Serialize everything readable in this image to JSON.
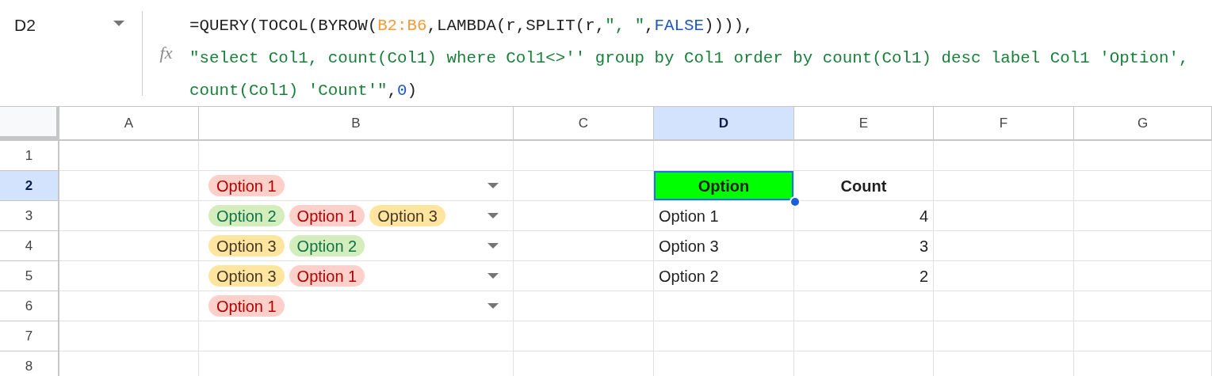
{
  "name_box": {
    "text": "D2"
  },
  "formula": {
    "icon_text": "fx",
    "lines": [
      [
        {
          "kind": "plain",
          "text": "=QUERY(TOCOL(BYROW("
        },
        {
          "kind": "range",
          "text": "B2:B6"
        },
        {
          "kind": "plain",
          "text": ",LAMBDA(r,SPLIT(r,"
        },
        {
          "kind": "string",
          "text": "\", \""
        },
        {
          "kind": "plain",
          "text": ","
        },
        {
          "kind": "bool",
          "text": "FALSE"
        },
        {
          "kind": "plain",
          "text": ")))),"
        }
      ],
      [
        {
          "kind": "string",
          "text": "\"select Col1, count(Col1) where Col1<>'' group by Col1 order by count(Col1) desc label Col1 'Option',"
        }
      ],
      [
        {
          "kind": "string",
          "text": "count(Col1) 'Count'\""
        },
        {
          "kind": "plain",
          "text": ","
        },
        {
          "kind": "number",
          "text": "0"
        },
        {
          "kind": "plain",
          "text": ")"
        }
      ]
    ]
  },
  "columns": [
    {
      "label": "A",
      "selected": false
    },
    {
      "label": "B",
      "selected": false
    },
    {
      "label": "C",
      "selected": false
    },
    {
      "label": "D",
      "selected": true
    },
    {
      "label": "E",
      "selected": false
    },
    {
      "label": "F",
      "selected": false
    },
    {
      "label": "G",
      "selected": false
    }
  ],
  "rows": [
    {
      "label": "1",
      "selected": false,
      "cells": [
        {
          "kind": "empty"
        },
        {
          "kind": "empty"
        },
        {
          "kind": "empty"
        },
        {
          "kind": "empty"
        },
        {
          "kind": "empty"
        },
        {
          "kind": "empty"
        },
        {
          "kind": "empty"
        }
      ]
    },
    {
      "label": "2",
      "selected": true,
      "cells": [
        {
          "kind": "empty"
        },
        {
          "kind": "chips",
          "chips": [
            {
              "label": "Option 1",
              "color": "#ffcfc9"
            }
          ]
        },
        {
          "kind": "empty"
        },
        {
          "kind": "header",
          "text": "Option",
          "color": "#00ff00"
        },
        {
          "kind": "header",
          "text": "Count"
        },
        {
          "kind": "empty"
        },
        {
          "kind": "empty"
        }
      ]
    },
    {
      "label": "3",
      "selected": false,
      "cells": [
        {
          "kind": "empty"
        },
        {
          "kind": "chips",
          "chips": [
            {
              "label": "Option 2",
              "color": "#d4edbc"
            },
            {
              "label": "Option 1",
              "color": "#ffcfc9"
            },
            {
              "label": "Option 3",
              "color": "#ffe5a0"
            }
          ]
        },
        {
          "kind": "empty"
        },
        {
          "kind": "text",
          "text": "Option 1"
        },
        {
          "kind": "number",
          "text": "4"
        },
        {
          "kind": "empty"
        },
        {
          "kind": "empty"
        }
      ]
    },
    {
      "label": "4",
      "selected": false,
      "cells": [
        {
          "kind": "empty"
        },
        {
          "kind": "chips",
          "chips": [
            {
              "label": "Option 3",
              "color": "#ffe5a0"
            },
            {
              "label": "Option 2",
              "color": "#d4edbc"
            }
          ]
        },
        {
          "kind": "empty"
        },
        {
          "kind": "text",
          "text": "Option 3"
        },
        {
          "kind": "number",
          "text": "3"
        },
        {
          "kind": "empty"
        },
        {
          "kind": "empty"
        }
      ]
    },
    {
      "label": "5",
      "selected": false,
      "cells": [
        {
          "kind": "empty"
        },
        {
          "kind": "chips",
          "chips": [
            {
              "label": "Option 3",
              "color": "#ffe5a0"
            },
            {
              "label": "Option 1",
              "color": "#ffcfc9"
            }
          ]
        },
        {
          "kind": "empty"
        },
        {
          "kind": "text",
          "text": "Option 2"
        },
        {
          "kind": "number",
          "text": "2"
        },
        {
          "kind": "empty"
        },
        {
          "kind": "empty"
        }
      ]
    },
    {
      "label": "6",
      "selected": false,
      "cells": [
        {
          "kind": "empty"
        },
        {
          "kind": "chips",
          "chips": [
            {
              "label": "Option 1",
              "color": "#ffcfc9"
            }
          ]
        },
        {
          "kind": "empty"
        },
        {
          "kind": "empty"
        },
        {
          "kind": "empty"
        },
        {
          "kind": "empty"
        },
        {
          "kind": "empty"
        }
      ]
    },
    {
      "label": "7",
      "selected": false,
      "cells": [
        {
          "kind": "empty"
        },
        {
          "kind": "empty"
        },
        {
          "kind": "empty"
        },
        {
          "kind": "empty"
        },
        {
          "kind": "empty"
        },
        {
          "kind": "empty"
        },
        {
          "kind": "empty"
        }
      ]
    },
    {
      "label": "8",
      "selected": false,
      "cells": [
        {
          "kind": "empty"
        },
        {
          "kind": "empty"
        },
        {
          "kind": "empty"
        },
        {
          "kind": "empty"
        },
        {
          "kind": "empty"
        },
        {
          "kind": "empty"
        },
        {
          "kind": "empty"
        }
      ]
    }
  ]
}
